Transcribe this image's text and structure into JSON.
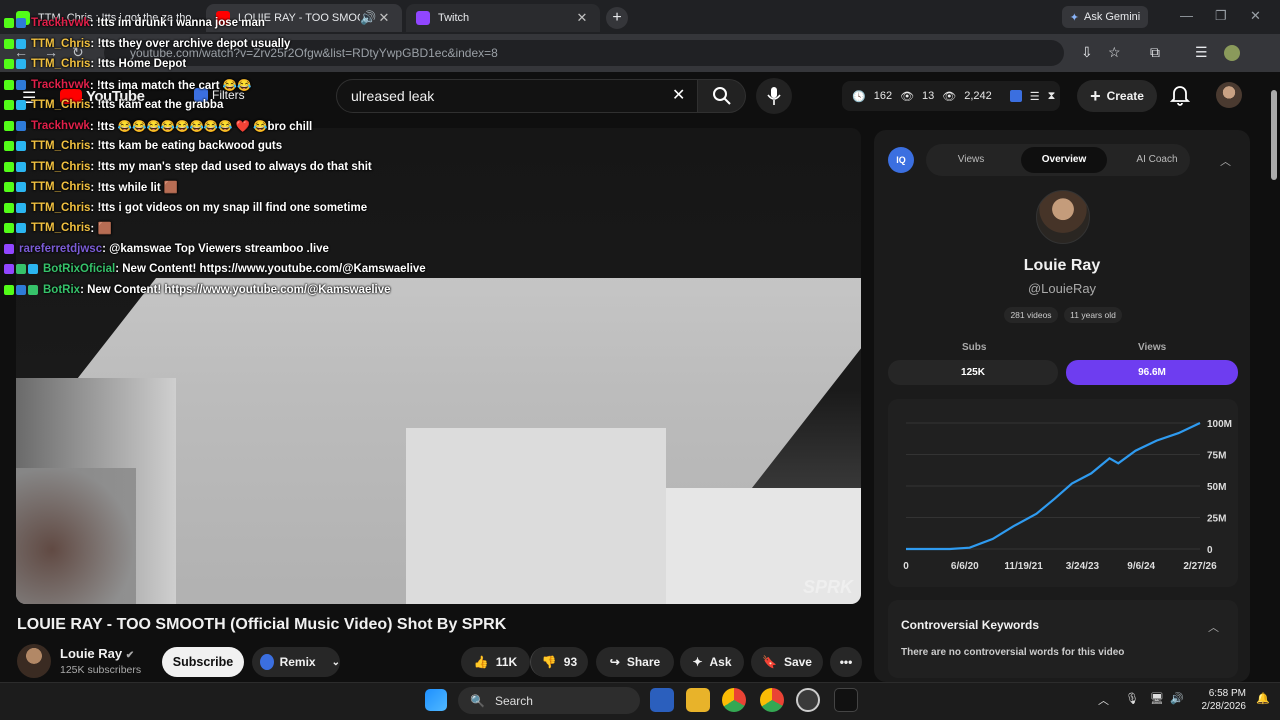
{
  "browser": {
    "tabs": [
      {
        "label": "TTM_Chris : !tts i got the za tho",
        "favicon_color": "#53fc18"
      },
      {
        "label": "LOUIE RAY - TOO SMOOTH",
        "favicon_color": "#ff0000"
      },
      {
        "label": "Twitch",
        "favicon_color": "#9146ff"
      }
    ],
    "gemini_label": "Ask Gemini",
    "url": "youtube.com/watch?v=Zrv25r2Ofgw&list=RDtyYwpGBD1ec&index=8"
  },
  "youtube": {
    "logo_text": "YouTube",
    "extension_label": "Filters",
    "search_value": "ulreased leak",
    "stats": {
      "comments": "162",
      "watching": "13",
      "views": "2,242"
    },
    "create_label": "Create"
  },
  "chat": [
    {
      "badges": [
        "k",
        "s"
      ],
      "user": "Trackhvwk",
      "color": "#e0204a",
      "message": ": !tts im drunk i wanna jose man"
    },
    {
      "badges": [
        "k",
        "c"
      ],
      "user": "TTM_Chris",
      "color": "#f0c040",
      "message": ": !tts they over archive depot usually"
    },
    {
      "badges": [
        "k",
        "c"
      ],
      "user": "TTM_Chris",
      "color": "#f0c040",
      "message": ": !tts Home Depot"
    },
    {
      "badges": [
        "k",
        "s"
      ],
      "user": "Trackhvwk",
      "color": "#e0204a",
      "message": ": !tts ima match the cart 😂😂"
    },
    {
      "badges": [
        "k",
        "c"
      ],
      "user": "TTM_Chris",
      "color": "#f0c040",
      "message": ": !tts kam eat the grabba"
    },
    {
      "badges": [
        "k",
        "s"
      ],
      "user": "Trackhvwk",
      "color": "#e0204a",
      "message": ": !tts 😂😂😂😂😂😂😂😂 ❤️ 😂bro chill"
    },
    {
      "badges": [
        "k",
        "c"
      ],
      "user": "TTM_Chris",
      "color": "#f0c040",
      "message": ": !tts kam be eating backwood guts"
    },
    {
      "badges": [
        "k",
        "c"
      ],
      "user": "TTM_Chris",
      "color": "#f0c040",
      "message": ": !tts my man's step dad used to always do that shit"
    },
    {
      "badges": [
        "k",
        "c"
      ],
      "user": "TTM_Chris",
      "color": "#f0c040",
      "message": ": !tts while lit 🟫"
    },
    {
      "badges": [
        "k",
        "c"
      ],
      "user": "TTM_Chris",
      "color": "#f0c040",
      "message": ": !tts i got videos on my snap ill find one sometime"
    },
    {
      "badges": [
        "k",
        "c"
      ],
      "user": "TTM_Chris",
      "color": "#f0c040",
      "message": ": 🟫"
    },
    {
      "badges": [
        "p"
      ],
      "user": "rareferretdjwsc",
      "color": "#7b5cd6",
      "message": ": @kamswae Top Viewers streamboo .live"
    },
    {
      "badges": [
        "p",
        "g",
        "c"
      ],
      "user": "BotRixOficial",
      "color": "#36c26a",
      "message": ": New Content! https://www.youtube.com/@Kamswaelive"
    },
    {
      "badges": [
        "k",
        "s",
        "g"
      ],
      "user": "BotRix",
      "color": "#36c26a",
      "message": ": New Content! https://www.youtube.com/@Kamswaelive"
    }
  ],
  "video": {
    "title": "LOUIE RAY - TOO SMOOTH (Official Music Video) Shot By SPRK",
    "watermark": "SPRK",
    "channel_name": "Louie Ray",
    "subscribers": "125K subscribers",
    "subscribe_label": "Subscribe",
    "remix_label": "Remix",
    "likes": "11K",
    "dislikes": "93",
    "share_label": "Share",
    "ask_label": "Ask",
    "save_label": "Save"
  },
  "panel": {
    "logo": "IQ",
    "tabs": [
      "Views",
      "Overview",
      "AI Coach"
    ],
    "active_tab": "Overview",
    "channel_name": "Louie Ray",
    "handle": "@LouieRay",
    "chips": [
      "281 videos",
      "11 years old"
    ],
    "subs_label": "Subs",
    "views_label": "Views",
    "subs_value": "125K",
    "views_value": "96.6M",
    "accent": "#6e3df0",
    "controversial_title": "Controversial Keywords",
    "controversial_text": "There are no controversial words for this video"
  },
  "chart_data": {
    "type": "line",
    "x": [
      "2019-06-06",
      "2020-06-06",
      "2020-11-19",
      "2021-06-01",
      "2021-11-19",
      "2022-06-01",
      "2022-11-01",
      "2023-03-24",
      "2023-09-01",
      "2024-02-01",
      "2024-04-15",
      "2024-09-06",
      "2025-03-01",
      "2025-09-01",
      "2026-02-27"
    ],
    "values": [
      0,
      0,
      1,
      8,
      18,
      28,
      40,
      52,
      60,
      72,
      68,
      78,
      86,
      92,
      100
    ],
    "xticks": [
      "0",
      "6/6/20",
      "11/19/21",
      "3/24/23",
      "9/6/24",
      "2/27/26"
    ],
    "yticks": [
      "0",
      "25M",
      "50M",
      "75M",
      "100M"
    ],
    "ylim": [
      0,
      100
    ],
    "line_color": "#2f9bf0",
    "grid": true
  },
  "taskbar": {
    "search_label": "Search",
    "time": "6:58 PM",
    "date": "2/28/2026"
  }
}
